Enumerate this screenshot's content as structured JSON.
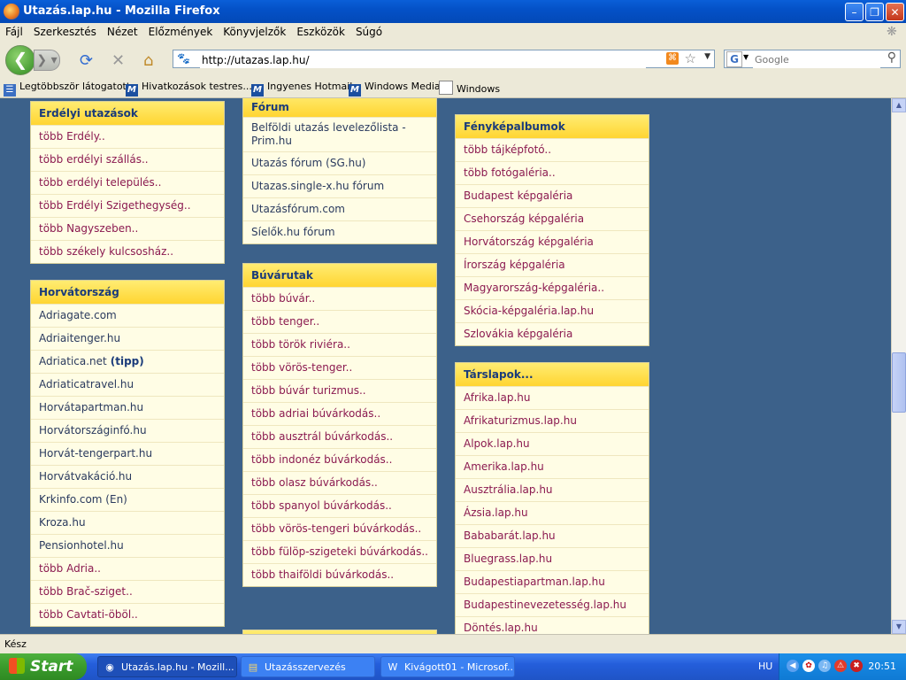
{
  "window": {
    "title": "Utazás.lap.hu - Mozilla Firefox"
  },
  "menu": [
    "Fájl",
    "Szerkesztés",
    "Nézet",
    "Előzmények",
    "Könyvjelzők",
    "Eszközök",
    "Súgó"
  ],
  "navbar": {
    "url": "http://utazas.lap.hu/",
    "search_placeholder": "Google"
  },
  "bookmarks": [
    "Legtöbbször látogatott",
    "Hivatkozások testres...",
    "Ingyenes Hotmail",
    "Windows Media",
    "Windows"
  ],
  "col1": [
    {
      "title": "Erdélyi utazások",
      "items": [
        "több Erdély..",
        "több erdélyi szállás..",
        "több erdélyi település..",
        "több Erdélyi Szigethegység..",
        "több Nagyszeben..",
        "több székely kulcsosház.."
      ]
    },
    {
      "title": "Horvátország",
      "items": [
        "Adriagate.com",
        "Adriaitenger.hu",
        "Adriatica.net",
        "Adriaticatravel.hu",
        "Horvátapartman.hu",
        "Horvátországinfó.hu",
        "Horvát-tengerpart.hu",
        "Horvátvakáció.hu",
        "Krkinfo.com (En)",
        "Kroza.hu",
        "Pensionhotel.hu",
        "több Adria..",
        "több Brač-sziget..",
        "több Cavtati-öböl.."
      ],
      "tipp": "(tipp)"
    }
  ],
  "col2": [
    {
      "title": "Fórum",
      "items": [
        "Belföldi utazás levelezőlista - Prim.hu",
        "Utazás fórum (SG.hu)",
        "Utazas.single-x.hu fórum",
        "Utazásfórum.com",
        "Síelők.hu fórum"
      ]
    },
    {
      "title": "Búvárutak",
      "items": [
        "több búvár..",
        "több tenger..",
        "több török riviéra..",
        "több vörös-tenger..",
        "több búvár turizmus..",
        "több adriai búvárkodás..",
        "több ausztrál búvárkodás..",
        "több indonéz búvárkodás..",
        "több olasz búvárkodás..",
        "több spanyol búvárkodás..",
        "több vörös-tengeri búvárkodás..",
        "több fülöp-szigeteki búvárkodás..",
        "több thaiföldi búvárkodás.."
      ]
    }
  ],
  "col3": [
    {
      "title": "Fényképalbumok",
      "items": [
        "több tájképfotó..",
        "több fotógaléria..",
        "Budapest képgaléria",
        "Csehország képgaléria",
        "Horvátország képgaléria",
        "Írország képgaléria",
        "Magyarország-képgaléria..",
        "Skócia-képgaléria.lap.hu",
        "Szlovákia képgaléria"
      ]
    },
    {
      "title": "Társlapok...",
      "items": [
        "Afrika.lap.hu",
        "Afrikaturizmus.lap.hu",
        "Alpok.lap.hu",
        "Amerika.lap.hu",
        "Ausztrália.lap.hu",
        "Ázsia.lap.hu",
        "Bababarát.lap.hu",
        "Bluegrass.lap.hu",
        "Budapestiapartman.lap.hu",
        "Budapestinevezetesség.lap.hu",
        "Döntés.lap.hu"
      ]
    }
  ],
  "status": "Kész",
  "taskbar": {
    "start": "Start",
    "tasks": [
      "Utazás.lap.hu - Mozill...",
      "Utazásszervezés",
      "Kivágott01 - Microsof..."
    ],
    "lang": "HU",
    "clock": "20:51"
  }
}
